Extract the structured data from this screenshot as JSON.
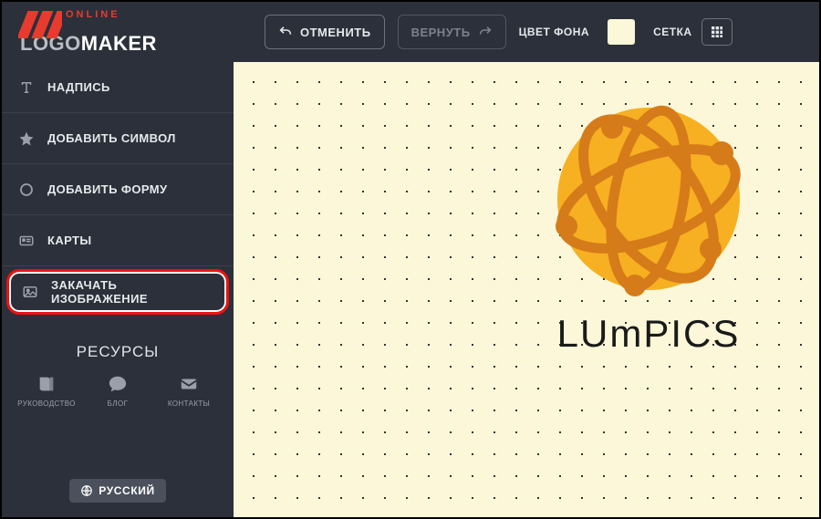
{
  "header": {
    "logo_top": "ONLINE",
    "logo_bottom_1": "LOGO",
    "logo_bottom_2": "MAKER",
    "undo_label": "ОТМЕНИТЬ",
    "redo_label": "ВЕРНУТЬ",
    "bgcolor_label": "ЦВЕТ ФОНА",
    "bgcolor_value": "#fbf7d8",
    "grid_label": "СЕТКА"
  },
  "sidebar": {
    "items": [
      {
        "icon": "text-icon",
        "label": "НАДПИСЬ"
      },
      {
        "icon": "star-icon",
        "label": "ДОБАВИТЬ СИМВОЛ"
      },
      {
        "icon": "circle-icon",
        "label": "ДОБАВИТЬ ФОРМУ"
      },
      {
        "icon": "card-icon",
        "label": "КАРТЫ"
      },
      {
        "icon": "image-icon",
        "label": "ЗАКАЧАТЬ ИЗОБРАЖЕНИЕ"
      }
    ],
    "resources_title": "РЕСУРСЫ",
    "resources": [
      {
        "icon": "book-icon",
        "label": "РУКОВОДСТВО"
      },
      {
        "icon": "chat-icon",
        "label": "БЛОГ"
      },
      {
        "icon": "mail-icon",
        "label": "КОНТАКТЫ"
      }
    ],
    "language_label": "РУССКИЙ"
  },
  "canvas": {
    "logo_text": "LUmPICS",
    "globe_fill": "#f6b021",
    "globe_stroke": "#d57b1a"
  }
}
